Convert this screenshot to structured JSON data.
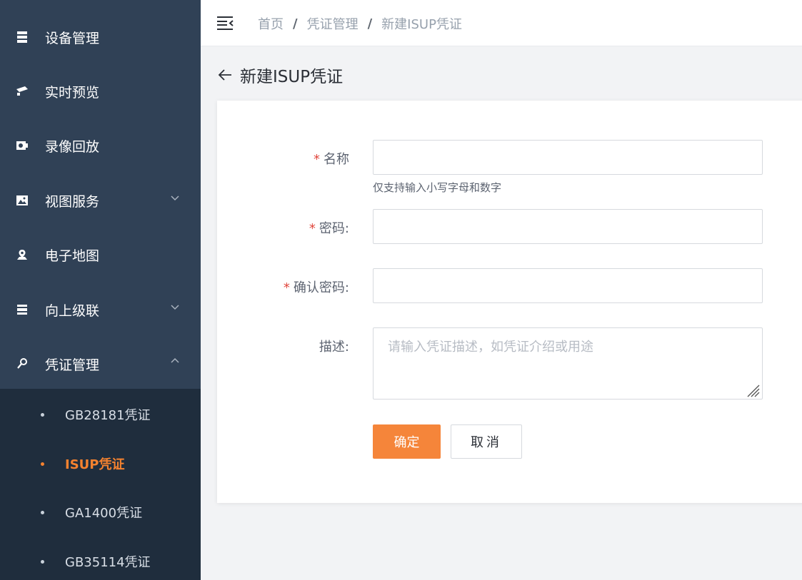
{
  "sidebar": {
    "items": [
      {
        "label": "设备管理",
        "icon": "server-icon"
      },
      {
        "label": "实时预览",
        "icon": "camera-icon"
      },
      {
        "label": "录像回放",
        "icon": "video-icon"
      },
      {
        "label": "视图服务",
        "icon": "image-icon"
      },
      {
        "label": "电子地图",
        "icon": "map-pin-icon"
      },
      {
        "label": "向上级联",
        "icon": "cascade-icon"
      },
      {
        "label": "凭证管理",
        "icon": "key-icon"
      }
    ],
    "subitems": [
      {
        "label": "GB28181凭证"
      },
      {
        "label": "ISUP凭证",
        "active": true
      },
      {
        "label": "GA1400凭证"
      },
      {
        "label": "GB35114凭证"
      }
    ]
  },
  "header": {
    "breadcrumb": [
      "首页",
      "凭证管理",
      "新建ISUP凭证"
    ],
    "separator": "/"
  },
  "page": {
    "title": "新建ISUP凭证"
  },
  "form": {
    "name_label": "名称",
    "name_value": "",
    "name_hint": "仅支持输入小写字母和数字",
    "password_label": "密码:",
    "password_value": "",
    "confirm_label": "确认密码:",
    "confirm_value": "",
    "desc_label": "描述:",
    "desc_placeholder": "请输入凭证描述，如凭证介绍或用途",
    "required_mark": "*",
    "confirm_button": "确定",
    "cancel_button": "取消"
  },
  "colors": {
    "sidebar_bg": "#304156",
    "submenu_bg": "#1f2d3d",
    "accent": "#f5853a",
    "required": "#e0463c"
  }
}
